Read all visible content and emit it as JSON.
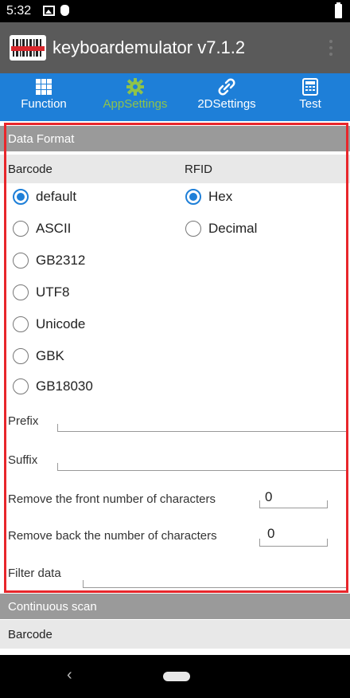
{
  "status_bar": {
    "time": "5:32"
  },
  "app_bar": {
    "title": "keyboardemulator v7.1.2"
  },
  "tabs": [
    {
      "label": "Function",
      "icon": "grid-icon",
      "active": false
    },
    {
      "label": "AppSettings",
      "icon": "gear-icon",
      "active": true
    },
    {
      "label": "2DSettings",
      "icon": "link-icon",
      "active": false
    },
    {
      "label": "Test",
      "icon": "calculator-icon",
      "active": false
    }
  ],
  "data_format": {
    "header": "Data Format",
    "barcode_label": "Barcode",
    "rfid_label": "RFID",
    "barcode_options": [
      "default",
      "ASCII",
      "GB2312",
      "UTF8",
      "Unicode",
      "GBK",
      "GB18030"
    ],
    "barcode_selected": "default",
    "rfid_options": [
      "Hex",
      "Decimal"
    ],
    "rfid_selected": "Hex",
    "prefix_label": "Prefix",
    "prefix_value": "",
    "suffix_label": "Suffix",
    "suffix_value": "",
    "remove_front_label": "Remove the front number of characters",
    "remove_front_value": "0",
    "remove_back_label": "Remove back the number of characters",
    "remove_back_value": "0",
    "filter_label": "Filter data",
    "filter_value": ""
  },
  "continuous_scan": {
    "header": "Continuous scan",
    "barcode_label": "Barcode"
  },
  "colors": {
    "tab_bar": "#1e7fd8",
    "active_tab": "#8fc34a",
    "highlight": "#e8262b",
    "app_bar": "#5a5a5a"
  }
}
